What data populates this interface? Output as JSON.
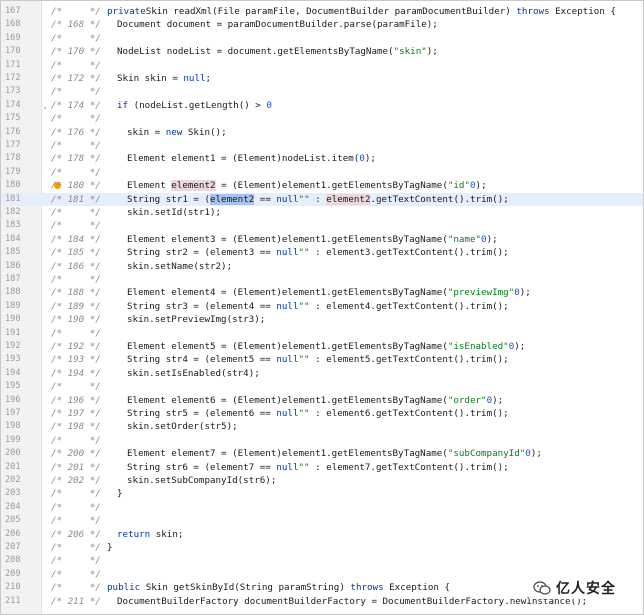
{
  "editor": {
    "watermark": "亿人安全",
    "rows": [
      {
        "ln": "167",
        "cmt": "/*     */",
        "indent": 0,
        "tokens": [
          [
            "kw",
            "private"
          ],
          [
            "",
            "Skin readXml(File paramFile, DocumentBuilder paramDocumentBuilder) "
          ],
          [
            "kw",
            "throws"
          ],
          [
            "",
            " Exception {"
          ]
        ]
      },
      {
        "ln": "168",
        "cmt": "/* 168 */",
        "indent": 1,
        "tokens": [
          [
            "",
            "Document document = paramDocumentBuilder.parse(paramFile);"
          ]
        ]
      },
      {
        "ln": "169",
        "cmt": "/*     */",
        "indent": 0,
        "tokens": []
      },
      {
        "ln": "170",
        "cmt": "/* 170 */",
        "indent": 1,
        "tokens": [
          [
            "",
            "NodeList nodeList = document.getElementsByTagName("
          ],
          [
            "str",
            "\"skin\""
          ],
          [
            "",
            ");"
          ]
        ]
      },
      {
        "ln": "171",
        "cmt": "/*     */",
        "indent": 0,
        "tokens": []
      },
      {
        "ln": "172",
        "cmt": "/* 172 */",
        "indent": 1,
        "tokens": [
          [
            "",
            "Skin skin = "
          ],
          [
            "kw",
            "null"
          ],
          [
            "",
            ";"
          ]
        ]
      },
      {
        "ln": "173",
        "cmt": "/*     */",
        "indent": 0,
        "tokens": []
      },
      {
        "ln": "174",
        "cmt": "/* 174 */",
        "indent": 1,
        "fold": true,
        "tokens": [
          [
            "kw",
            "if"
          ],
          [
            "",
            " (nodeList.getLength() > "
          ],
          [
            "num",
            "0"
          ],
          [
            ") {"
          ]
        ]
      },
      {
        "ln": "175",
        "cmt": "/*     */",
        "indent": 0,
        "tokens": []
      },
      {
        "ln": "176",
        "cmt": "/* 176 */",
        "indent": 2,
        "tokens": [
          [
            "",
            "skin = "
          ],
          [
            "kw",
            "new"
          ],
          [
            "",
            " Skin();"
          ]
        ]
      },
      {
        "ln": "177",
        "cmt": "/*     */",
        "indent": 0,
        "tokens": []
      },
      {
        "ln": "178",
        "cmt": "/* 178 */",
        "indent": 2,
        "tokens": [
          [
            "",
            "Element element1 = (Element)nodeList.item("
          ],
          [
            "num",
            "0"
          ],
          [
            "",
            ");"
          ]
        ]
      },
      {
        "ln": "179",
        "cmt": "/*     */",
        "indent": 0,
        "tokens": []
      },
      {
        "ln": "180",
        "cmt": "/* 180 */",
        "indent": 2,
        "bulb": true,
        "tokens": [
          [
            "",
            "Element "
          ],
          [
            "usage",
            "element2"
          ],
          [
            "",
            " = (Element)element1.getElementsByTagName("
          ],
          [
            "str",
            "\"id\""
          ],
          [
            ").item("
          ],
          [
            "num",
            "0"
          ],
          [
            "",
            ");"
          ]
        ]
      },
      {
        "ln": "181",
        "cmt": "/* 181 */",
        "indent": 2,
        "hl": true,
        "tokens": [
          [
            "",
            "String str1 = ("
          ],
          [
            "sel",
            "element2"
          ],
          [
            "",
            " == "
          ],
          [
            "kw",
            "null"
          ],
          [
            ") ? "
          ],
          [
            "str",
            "\"\""
          ],
          [
            "",
            " : "
          ],
          [
            "usage",
            "element2"
          ],
          [
            "",
            ".getTextContent().trim();"
          ]
        ]
      },
      {
        "ln": "182",
        "cmt": "/*     */",
        "indent": 2,
        "tokens": [
          [
            "",
            "skin.setId(str1);"
          ]
        ]
      },
      {
        "ln": "183",
        "cmt": "/*     */",
        "indent": 0,
        "tokens": []
      },
      {
        "ln": "184",
        "cmt": "/* 184 */",
        "indent": 2,
        "tokens": [
          [
            "",
            "Element element3 = (Element)element1.getElementsByTagName("
          ],
          [
            "str",
            "\"name\""
          ],
          [
            ").item("
          ],
          [
            "num",
            "0"
          ],
          [
            "",
            ");"
          ]
        ]
      },
      {
        "ln": "185",
        "cmt": "/* 185 */",
        "indent": 2,
        "tokens": [
          [
            "",
            "String str2 = (element3 == "
          ],
          [
            "kw",
            "null"
          ],
          [
            ") ? "
          ],
          [
            "str",
            "\"\""
          ],
          [
            "",
            " : element3.getTextContent().trim();"
          ]
        ]
      },
      {
        "ln": "186",
        "cmt": "/* 186 */",
        "indent": 2,
        "tokens": [
          [
            "",
            "skin.setName(str2);"
          ]
        ]
      },
      {
        "ln": "187",
        "cmt": "/*     */",
        "indent": 0,
        "tokens": []
      },
      {
        "ln": "188",
        "cmt": "/* 188 */",
        "indent": 2,
        "tokens": [
          [
            "",
            "Element element4 = (Element)element1.getElementsByTagName("
          ],
          [
            "str",
            "\"previewImg\""
          ],
          [
            ").item("
          ],
          [
            "num",
            "0"
          ],
          [
            "",
            ");"
          ]
        ]
      },
      {
        "ln": "189",
        "cmt": "/* 189 */",
        "indent": 2,
        "tokens": [
          [
            "",
            "String str3 = (element4 == "
          ],
          [
            "kw",
            "null"
          ],
          [
            ") ? "
          ],
          [
            "str",
            "\"\""
          ],
          [
            "",
            " : element4.getTextContent().trim();"
          ]
        ]
      },
      {
        "ln": "190",
        "cmt": "/* 190 */",
        "indent": 2,
        "tokens": [
          [
            "",
            "skin.setPreviewImg(str3);"
          ]
        ]
      },
      {
        "ln": "191",
        "cmt": "/*     */",
        "indent": 0,
        "tokens": []
      },
      {
        "ln": "192",
        "cmt": "/* 192 */",
        "indent": 2,
        "tokens": [
          [
            "",
            "Element element5 = (Element)element1.getElementsByTagName("
          ],
          [
            "str",
            "\"isEnabled\""
          ],
          [
            ").item("
          ],
          [
            "num",
            "0"
          ],
          [
            "",
            ");"
          ]
        ]
      },
      {
        "ln": "193",
        "cmt": "/* 193 */",
        "indent": 2,
        "tokens": [
          [
            "",
            "String str4 = (element5 == "
          ],
          [
            "kw",
            "null"
          ],
          [
            ") ? "
          ],
          [
            "str",
            "\"\""
          ],
          [
            "",
            " : element5.getTextContent().trim();"
          ]
        ]
      },
      {
        "ln": "194",
        "cmt": "/* 194 */",
        "indent": 2,
        "tokens": [
          [
            "",
            "skin.setIsEnabled(str4);"
          ]
        ]
      },
      {
        "ln": "195",
        "cmt": "/*     */",
        "indent": 0,
        "tokens": []
      },
      {
        "ln": "196",
        "cmt": "/* 196 */",
        "indent": 2,
        "tokens": [
          [
            "",
            "Element element6 = (Element)element1.getElementsByTagName("
          ],
          [
            "str",
            "\"order\""
          ],
          [
            ").item("
          ],
          [
            "num",
            "0"
          ],
          [
            "",
            ");"
          ]
        ]
      },
      {
        "ln": "197",
        "cmt": "/* 197 */",
        "indent": 2,
        "tokens": [
          [
            "",
            "String str5 = (element6 == "
          ],
          [
            "kw",
            "null"
          ],
          [
            ") ? "
          ],
          [
            "str",
            "\"\""
          ],
          [
            "",
            " : element6.getTextContent().trim();"
          ]
        ]
      },
      {
        "ln": "198",
        "cmt": "/* 198 */",
        "indent": 2,
        "tokens": [
          [
            "",
            "skin.setOrder(str5);"
          ]
        ]
      },
      {
        "ln": "199",
        "cmt": "/*     */",
        "indent": 0,
        "tokens": []
      },
      {
        "ln": "200",
        "cmt": "/* 200 */",
        "indent": 2,
        "tokens": [
          [
            "",
            "Element element7 = (Element)element1.getElementsByTagName("
          ],
          [
            "str",
            "\"subCompanyId\""
          ],
          [
            ").item("
          ],
          [
            "num",
            "0"
          ],
          [
            "",
            ");"
          ]
        ]
      },
      {
        "ln": "201",
        "cmt": "/* 201 */",
        "indent": 2,
        "tokens": [
          [
            "",
            "String str6 = (element7 == "
          ],
          [
            "kw",
            "null"
          ],
          [
            ") ? "
          ],
          [
            "str",
            "\"\""
          ],
          [
            "",
            " : element7.getTextContent().trim();"
          ]
        ]
      },
      {
        "ln": "202",
        "cmt": "/* 202 */",
        "indent": 2,
        "tokens": [
          [
            "",
            "skin.setSubCompanyId(str6);"
          ]
        ]
      },
      {
        "ln": "203",
        "cmt": "/*     */",
        "indent": 1,
        "tokens": [
          [
            "",
            "}"
          ]
        ]
      },
      {
        "ln": "204",
        "cmt": "/*     */",
        "indent": 0,
        "tokens": []
      },
      {
        "ln": "205",
        "cmt": "/*     */",
        "indent": 0,
        "tokens": []
      },
      {
        "ln": "206",
        "cmt": "/* 206 */",
        "indent": 1,
        "tokens": [
          [
            "kw",
            "return"
          ],
          [
            "",
            " skin;"
          ]
        ]
      },
      {
        "ln": "207",
        "cmt": "/*     */",
        "indent": 0,
        "tokens": [
          [
            "",
            "}"
          ]
        ]
      },
      {
        "ln": "208",
        "cmt": "/*     */",
        "indent": 0,
        "tokens": []
      },
      {
        "ln": "209",
        "cmt": "/*     */",
        "indent": 0,
        "tokens": []
      },
      {
        "ln": "210",
        "cmt": "/*     */",
        "indent": 0,
        "tokens": [
          [
            "kw",
            "public"
          ],
          [
            "",
            " Skin getSkinById(String paramString) "
          ],
          [
            "kw",
            "throws"
          ],
          [
            "",
            " Exception {"
          ]
        ]
      },
      {
        "ln": "211",
        "cmt": "/* 211 */",
        "indent": 1,
        "tokens": [
          [
            "",
            "DocumentBuilderFactory documentBuilderFactory = DocumentBuilderFactory.newInstance();"
          ]
        ]
      }
    ]
  }
}
